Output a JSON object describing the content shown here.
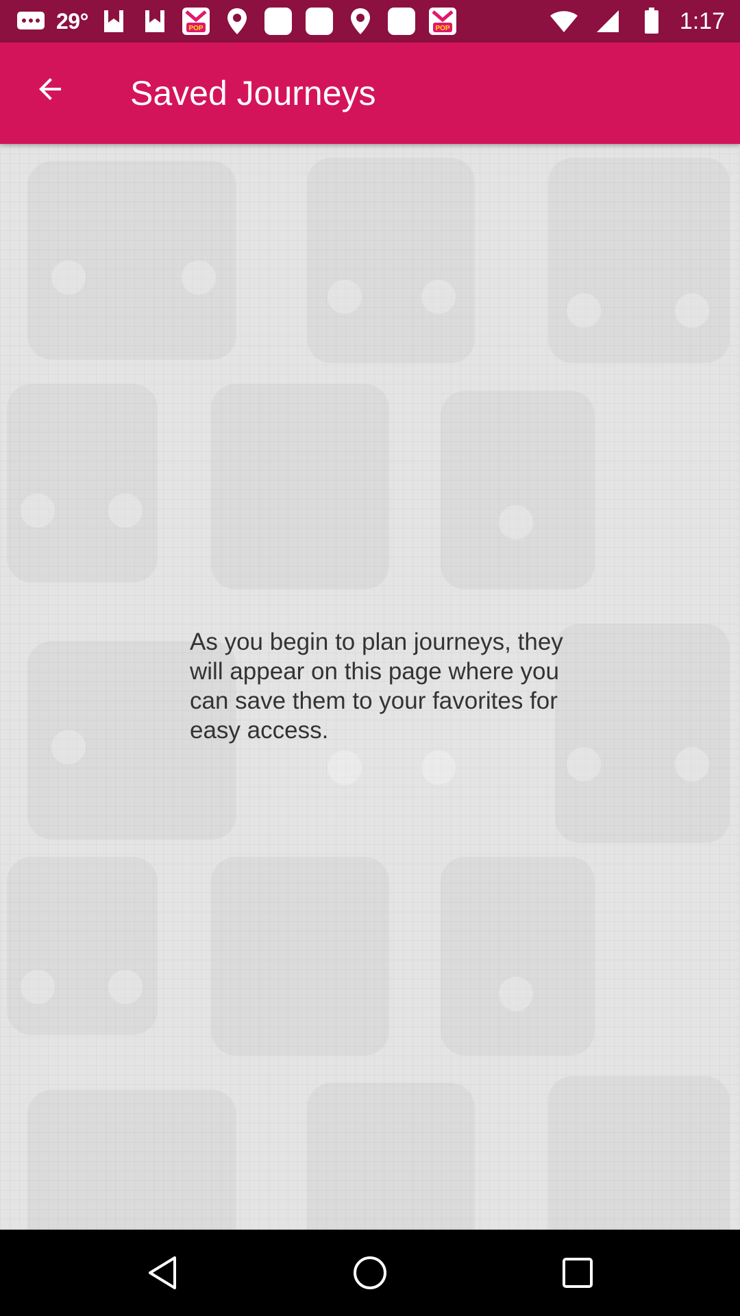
{
  "status_bar": {
    "temperature": "29°",
    "time": "1:17",
    "notification_icons": [
      "message-icon",
      "news-icon",
      "news-icon",
      "pop-app-icon",
      "location-icon",
      "app-icon",
      "app-icon",
      "location-icon",
      "app-icon",
      "pop-app-icon"
    ]
  },
  "app_bar": {
    "title": "Saved Journeys",
    "back_icon": "arrow-back-icon"
  },
  "main": {
    "empty_message": "As you begin to plan journeys, they will appear on this page where you can save them to your favorites for easy access."
  },
  "nav_bar": {
    "buttons": [
      "back-triangle-icon",
      "home-circle-icon",
      "recents-square-icon"
    ]
  },
  "colors": {
    "status_bar": "#8c1040",
    "app_bar": "#d4145a",
    "background": "#e4e4e4",
    "text": "#333333"
  }
}
